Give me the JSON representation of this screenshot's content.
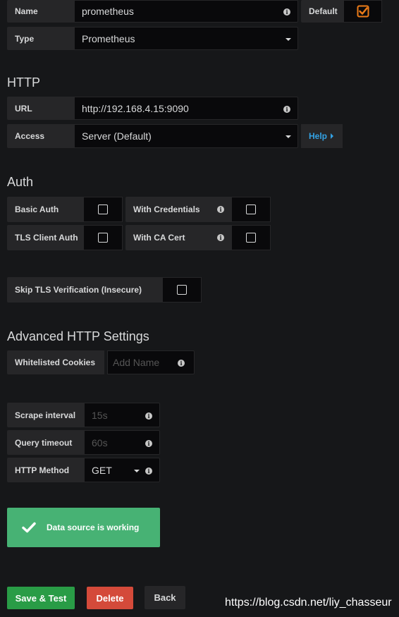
{
  "general": {
    "name_label": "Name",
    "name_value": "prometheus",
    "default_label": "Default",
    "default_checked": true,
    "type_label": "Type",
    "type_value": "Prometheus"
  },
  "http": {
    "heading": "HTTP",
    "url_label": "URL",
    "url_value": "http://192.168.4.15:9090",
    "access_label": "Access",
    "access_value": "Server (Default)",
    "help_label": "Help"
  },
  "auth": {
    "heading": "Auth",
    "basic_auth_label": "Basic Auth",
    "with_credentials_label": "With Credentials",
    "tls_client_auth_label": "TLS Client Auth",
    "with_ca_cert_label": "With CA Cert",
    "skip_tls_label": "Skip TLS Verification (Insecure)"
  },
  "advanced": {
    "heading": "Advanced HTTP Settings",
    "whitelisted_cookies_label": "Whitelisted Cookies",
    "whitelisted_cookies_placeholder": "Add Name"
  },
  "prometheus": {
    "scrape_interval_label": "Scrape interval",
    "scrape_interval_placeholder": "15s",
    "query_timeout_label": "Query timeout",
    "query_timeout_placeholder": "60s",
    "http_method_label": "HTTP Method",
    "http_method_value": "GET"
  },
  "status": {
    "message": "Data source is working",
    "color": "#47b274"
  },
  "actions": {
    "save_test_label": "Save & Test",
    "delete_label": "Delete",
    "back_label": "Back"
  },
  "watermark": "https://blog.csdn.net/liy_chasseur",
  "colors": {
    "accent_orange": "#eb7b18",
    "save_green": "#299c46",
    "delete_red": "#d44a3a",
    "help_blue": "#33a2e5"
  }
}
